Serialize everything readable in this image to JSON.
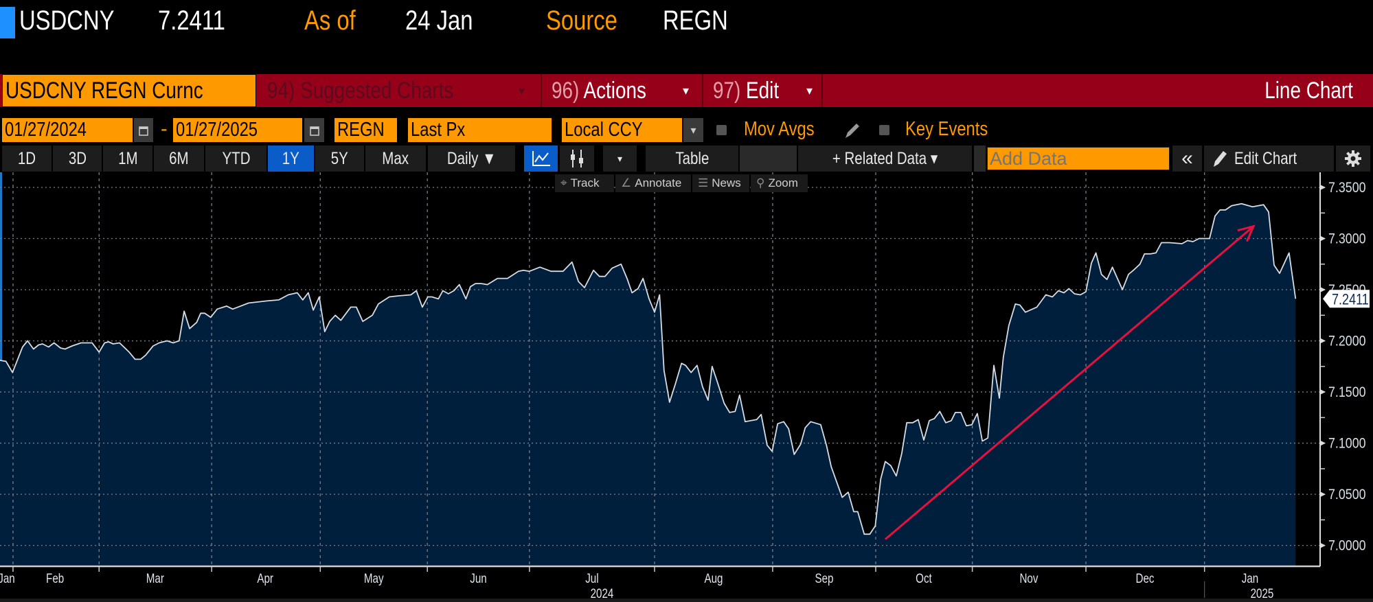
{
  "header": {
    "ticker": "USDCNY",
    "price": "7.2411",
    "as_of_label": "As of",
    "as_of_value": "24 Jan",
    "source_label": "Source",
    "source_value": "REGN"
  },
  "menubar": {
    "security": "USDCNY REGN Curnc",
    "suggested": "94) Suggested Charts",
    "actions_num": "96)",
    "actions": "Actions",
    "edit_num": "97)",
    "edit": "Edit",
    "chart_type": "Line Chart",
    "caret": "▾"
  },
  "controls": {
    "start_date": "01/27/2024",
    "dash": "-",
    "end_date": "01/27/2025",
    "source": "REGN",
    "field": "Last Px",
    "currency": "Local CCY",
    "mov_avgs": "Mov Avgs",
    "key_events": "Key Events"
  },
  "toolbar": {
    "ranges": [
      "1D",
      "3D",
      "1M",
      "6M",
      "YTD",
      "1Y",
      "5Y",
      "Max"
    ],
    "selected_range": "1Y",
    "frequency": "Daily ▼",
    "table": "Table",
    "related": "+ Related Data ▾",
    "add_data_placeholder": "Add Data",
    "collapse": "«",
    "edit_chart": "Edit Chart"
  },
  "mini_toolbar": {
    "track": "Track",
    "annotate": "Annotate",
    "news": "News",
    "zoom": "Zoom"
  },
  "colors": {
    "accent_orange": "#ff9900",
    "menu_red": "#960018",
    "area_fill": "#001f3d",
    "line": "#d6dde6",
    "arrow": "#e8103c",
    "selected_blue": "#0a5cc8"
  },
  "chart_data": {
    "type": "area",
    "series_name": "USDCNY Last Px",
    "x_unit": "trading days since 01/29/2024",
    "xlim": [
      0,
      263.8
    ],
    "ylim": [
      6.985,
      7.3535
    ],
    "yticks": [
      "7.0000",
      "7.0500",
      "7.1000",
      "7.1500",
      "7.2000",
      "7.2500",
      "7.3000",
      "7.3500"
    ],
    "ytick_values": [
      7.0,
      7.05,
      7.1,
      7.15,
      7.2,
      7.25,
      7.3,
      7.35
    ],
    "last_value": "7.2411",
    "grid": true,
    "month_ticks": [
      2.6,
      19.8,
      42.3,
      64,
      85.4,
      105.8,
      130.8,
      154.4,
      175,
      194.3,
      217,
      240.7
    ],
    "month_labels": [
      {
        "label": "Jan",
        "at": 1.3
      },
      {
        "label": "Feb",
        "at": 11
      },
      {
        "label": "Mar",
        "at": 31
      },
      {
        "label": "Apr",
        "at": 53
      },
      {
        "label": "May",
        "at": 74.7
      },
      {
        "label": "Jun",
        "at": 95.6
      },
      {
        "label": "Jul",
        "at": 118.3
      },
      {
        "label": "Aug",
        "at": 142.6
      },
      {
        "label": "Sep",
        "at": 164.7
      },
      {
        "label": "Oct",
        "at": 184.6
      },
      {
        "label": "Nov",
        "at": 205.6
      },
      {
        "label": "Dec",
        "at": 228.8
      },
      {
        "label": "Jan",
        "at": 249.8
      }
    ],
    "year_labels": [
      {
        "label": "2024",
        "at": 120.3
      },
      {
        "label": "2025",
        "at": 252.2
      }
    ],
    "year_break": 240.7,
    "annotation_arrow": {
      "from": [
        176.9,
        7.006
      ],
      "to": [
        250.5,
        7.312
      ]
    },
    "points": [
      [
        0,
        7.181
      ],
      [
        1.2,
        7.18
      ],
      [
        2.5,
        7.169
      ],
      [
        4.5,
        7.194
      ],
      [
        5.5,
        7.2
      ],
      [
        6.7,
        7.192
      ],
      [
        7.7,
        7.196
      ],
      [
        8.5,
        7.197
      ],
      [
        9.7,
        7.194
      ],
      [
        10.8,
        7.198
      ],
      [
        12.1,
        7.193
      ],
      [
        13,
        7.192
      ],
      [
        14.4,
        7.195
      ],
      [
        16.2,
        7.198
      ],
      [
        18.4,
        7.198
      ],
      [
        19.8,
        7.189
      ],
      [
        20.9,
        7.198
      ],
      [
        21.7,
        7.199
      ],
      [
        22.6,
        7.197
      ],
      [
        23.9,
        7.198
      ],
      [
        25.8,
        7.189
      ],
      [
        27,
        7.182
      ],
      [
        28.1,
        7.182
      ],
      [
        29.1,
        7.186
      ],
      [
        30.6,
        7.195
      ],
      [
        31.8,
        7.198
      ],
      [
        33.4,
        7.2
      ],
      [
        34.6,
        7.198
      ],
      [
        35.8,
        7.2
      ],
      [
        36.8,
        7.229
      ],
      [
        37.9,
        7.212
      ],
      [
        39.3,
        7.218
      ],
      [
        40.1,
        7.227
      ],
      [
        40.9,
        7.227
      ],
      [
        42.1,
        7.223
      ],
      [
        43.4,
        7.231
      ],
      [
        45.3,
        7.234
      ],
      [
        46.5,
        7.231
      ],
      [
        49.7,
        7.237
      ],
      [
        53.3,
        7.239
      ],
      [
        55.7,
        7.24
      ],
      [
        57.6,
        7.245
      ],
      [
        59.4,
        7.247
      ],
      [
        60.5,
        7.24
      ],
      [
        61.6,
        7.247
      ],
      [
        62.6,
        7.23
      ],
      [
        63.8,
        7.243
      ],
      [
        64.9,
        7.209
      ],
      [
        65.9,
        7.219
      ],
      [
        67,
        7.225
      ],
      [
        68.1,
        7.22
      ],
      [
        70.1,
        7.233
      ],
      [
        71.2,
        7.233
      ],
      [
        72.5,
        7.219
      ],
      [
        74.4,
        7.225
      ],
      [
        75.6,
        7.236
      ],
      [
        77.8,
        7.243
      ],
      [
        79.6,
        7.244
      ],
      [
        82.1,
        7.245
      ],
      [
        83.2,
        7.249
      ],
      [
        84.4,
        7.233
      ],
      [
        85.5,
        7.243
      ],
      [
        86.3,
        7.243
      ],
      [
        87.6,
        7.241
      ],
      [
        88.5,
        7.249
      ],
      [
        89.6,
        7.246
      ],
      [
        90.7,
        7.249
      ],
      [
        91.8,
        7.255
      ],
      [
        93.1,
        7.241
      ],
      [
        94,
        7.253
      ],
      [
        95,
        7.256
      ],
      [
        96.2,
        7.256
      ],
      [
        97.4,
        7.255
      ],
      [
        99.4,
        7.261
      ],
      [
        101.4,
        7.261
      ],
      [
        103.6,
        7.268
      ],
      [
        104.6,
        7.269
      ],
      [
        105.8,
        7.268
      ],
      [
        107.9,
        7.272
      ],
      [
        110.1,
        7.268
      ],
      [
        112.5,
        7.268
      ],
      [
        114.3,
        7.277
      ],
      [
        115.6,
        7.258
      ],
      [
        116.8,
        7.252
      ],
      [
        118.6,
        7.269
      ],
      [
        119.8,
        7.263
      ],
      [
        120.9,
        7.263
      ],
      [
        122.3,
        7.271
      ],
      [
        124.1,
        7.275
      ],
      [
        125.3,
        7.261
      ],
      [
        126.3,
        7.247
      ],
      [
        127.5,
        7.251
      ],
      [
        128.5,
        7.261
      ],
      [
        129.7,
        7.241
      ],
      [
        130.8,
        7.228
      ],
      [
        131.8,
        7.245
      ],
      [
        132.7,
        7.171
      ],
      [
        133.8,
        7.14
      ],
      [
        134.9,
        7.157
      ],
      [
        136.2,
        7.178
      ],
      [
        137,
        7.176
      ],
      [
        138.1,
        7.169
      ],
      [
        139.3,
        7.176
      ],
      [
        140.4,
        7.155
      ],
      [
        141.5,
        7.142
      ],
      [
        142.3,
        7.175
      ],
      [
        143.4,
        7.159
      ],
      [
        144.7,
        7.139
      ],
      [
        145.8,
        7.13
      ],
      [
        146.9,
        7.131
      ],
      [
        147.8,
        7.147
      ],
      [
        148.9,
        7.121
      ],
      [
        151.2,
        7.123
      ],
      [
        152.1,
        7.128
      ],
      [
        153.3,
        7.098
      ],
      [
        154.3,
        7.092
      ],
      [
        155.4,
        7.119
      ],
      [
        156.6,
        7.121
      ],
      [
        157.6,
        7.114
      ],
      [
        158.7,
        7.089
      ],
      [
        160,
        7.099
      ],
      [
        160.9,
        7.115
      ],
      [
        162,
        7.121
      ],
      [
        164,
        7.118
      ],
      [
        165.2,
        7.097
      ],
      [
        166.1,
        7.077
      ],
      [
        168.3,
        7.047
      ],
      [
        169.5,
        7.052
      ],
      [
        170.6,
        7.033
      ],
      [
        171.4,
        7.033
      ],
      [
        172.7,
        7.011
      ],
      [
        173.8,
        7.011
      ],
      [
        174.9,
        7.019
      ],
      [
        176,
        7.065
      ],
      [
        176.9,
        7.082
      ],
      [
        178,
        7.078
      ],
      [
        179.1,
        7.068
      ],
      [
        180.2,
        7.09
      ],
      [
        181.2,
        7.12
      ],
      [
        182.4,
        7.12
      ],
      [
        183.5,
        7.123
      ],
      [
        184.6,
        7.103
      ],
      [
        185.7,
        7.122
      ],
      [
        186.7,
        7.124
      ],
      [
        187.8,
        7.131
      ],
      [
        189,
        7.12
      ],
      [
        190.1,
        7.122
      ],
      [
        190.9,
        7.13
      ],
      [
        192,
        7.13
      ],
      [
        193.1,
        7.117
      ],
      [
        194.2,
        7.118
      ],
      [
        195.3,
        7.129
      ],
      [
        196.3,
        7.102
      ],
      [
        197.4,
        7.105
      ],
      [
        198.6,
        7.176
      ],
      [
        199.7,
        7.144
      ],
      [
        200.5,
        7.184
      ],
      [
        201.6,
        7.215
      ],
      [
        202.9,
        7.236
      ],
      [
        203.8,
        7.235
      ],
      [
        204.9,
        7.228
      ],
      [
        207.2,
        7.233
      ],
      [
        209,
        7.245
      ],
      [
        210.3,
        7.243
      ],
      [
        211.5,
        7.249
      ],
      [
        212.6,
        7.247
      ],
      [
        213.6,
        7.251
      ],
      [
        214.7,
        7.246
      ],
      [
        215.9,
        7.245
      ],
      [
        217,
        7.248
      ],
      [
        218.1,
        7.276
      ],
      [
        219,
        7.286
      ],
      [
        220.1,
        7.265
      ],
      [
        221.2,
        7.26
      ],
      [
        222.3,
        7.272
      ],
      [
        224.3,
        7.25
      ],
      [
        225.5,
        7.265
      ],
      [
        226.5,
        7.269
      ],
      [
        227.8,
        7.275
      ],
      [
        228.7,
        7.285
      ],
      [
        229.9,
        7.285
      ],
      [
        231,
        7.286
      ],
      [
        232.1,
        7.296
      ],
      [
        233.7,
        7.296
      ],
      [
        236.2,
        7.295
      ],
      [
        237.3,
        7.298
      ],
      [
        238.4,
        7.297
      ],
      [
        239.6,
        7.3
      ],
      [
        241.7,
        7.3
      ],
      [
        242.8,
        7.322
      ],
      [
        243.8,
        7.328
      ],
      [
        244.9,
        7.328
      ],
      [
        246.1,
        7.332
      ],
      [
        248.1,
        7.334
      ],
      [
        250.3,
        7.331
      ],
      [
        252.5,
        7.333
      ],
      [
        253.5,
        7.326
      ],
      [
        254.6,
        7.274
      ],
      [
        255.7,
        7.266
      ],
      [
        257.6,
        7.286
      ],
      [
        258.9,
        7.2411
      ]
    ]
  }
}
